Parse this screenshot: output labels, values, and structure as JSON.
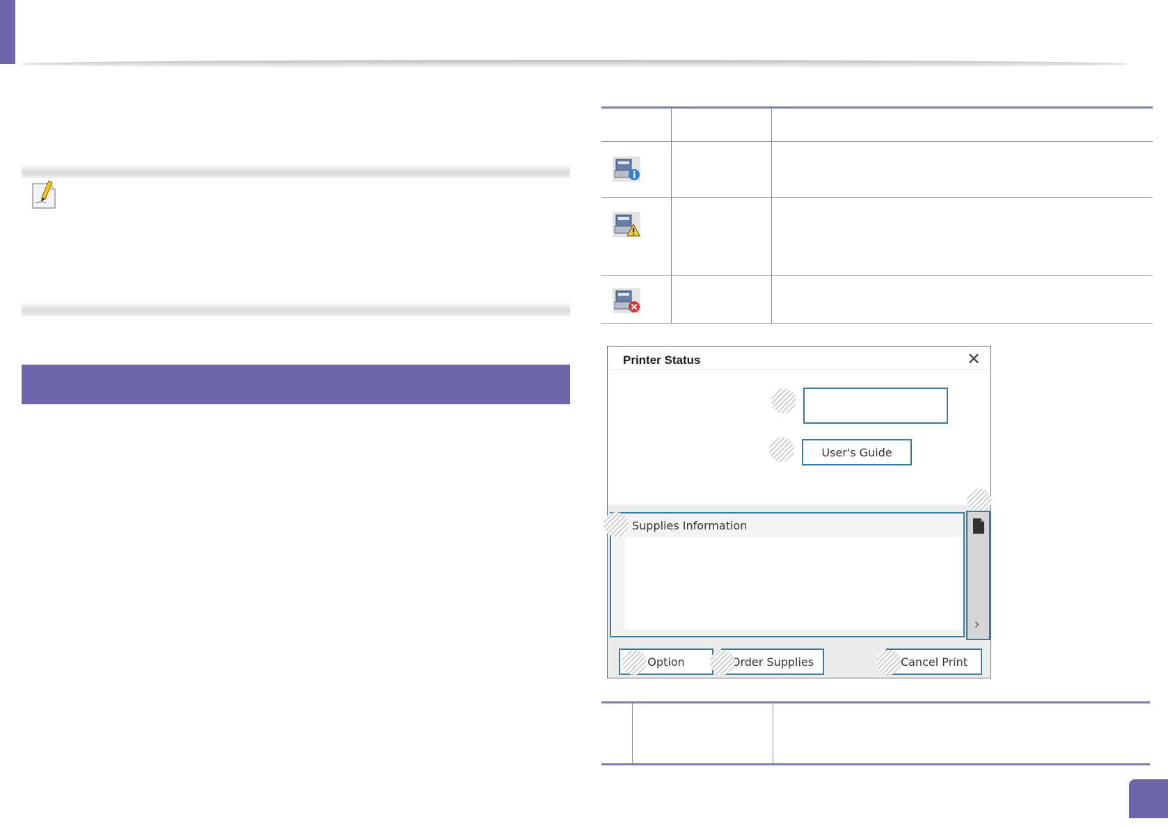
{
  "dialog": {
    "title": "Printer Status",
    "close_glyph": "✕",
    "users_guide_label": "User's Guide",
    "supplies_label": "Supplies Information",
    "buttons": {
      "option_label": "Option",
      "order_supplies_label": "Order Supplies",
      "cancel_print_label": "Cancel Print"
    },
    "chevron_glyph": "›"
  },
  "status_icons": [
    {
      "icon": "printer-info-icon",
      "badge_color": "#2f7fd6"
    },
    {
      "icon": "printer-warning-icon",
      "badge_color": "#f2d22a"
    },
    {
      "icon": "printer-error-icon",
      "badge_color": "#e03030"
    }
  ],
  "colors": {
    "accent": "#6e66ad",
    "button_border": "#3f7a9c"
  }
}
